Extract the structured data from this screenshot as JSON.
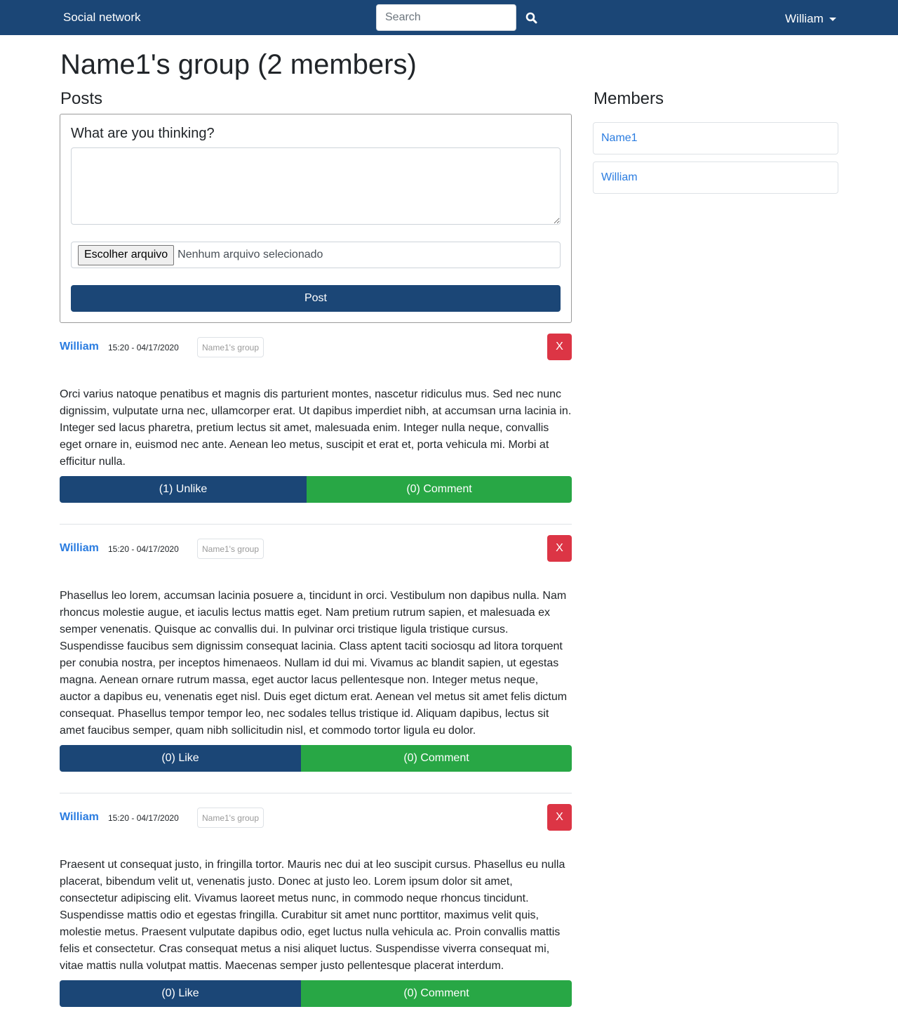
{
  "navbar": {
    "brand": "Social network",
    "search_placeholder": "Search",
    "search_value": "",
    "user_name": "William"
  },
  "page": {
    "title": "Name1's group (2 members)",
    "posts_title": "Posts",
    "members_title": "Members"
  },
  "composer": {
    "label": "What are you thinking?",
    "text_value": "",
    "file_button": "Escolher arquivo",
    "file_status": "Nenhum arquivo selecionado",
    "post_button": "Post"
  },
  "posts": [
    {
      "author": "William",
      "time": "15:20 - 04/17/2020",
      "group": "Name1's group",
      "delete_label": "X",
      "body": "Orci varius natoque penatibus et magnis dis parturient montes, nascetur ridiculus mus. Sed nec nunc dignissim, vulputate urna nec, ullamcorper erat. Ut dapibus imperdiet nibh, at accumsan urna lacinia in. Integer sed lacus pharetra, pretium lectus sit amet, malesuada enim. Integer nulla neque, convallis eget ornare in, euismod nec ante. Aenean leo metus, suscipit et erat et, porta vehicula mi. Morbi at efficitur nulla.",
      "like_label": "(1) Unlike",
      "comment_label": "(0) Comment"
    },
    {
      "author": "William",
      "time": "15:20 - 04/17/2020",
      "group": "Name1's group",
      "delete_label": "X",
      "body": "Phasellus leo lorem, accumsan lacinia posuere a, tincidunt in orci. Vestibulum non dapibus nulla. Nam rhoncus molestie augue, et iaculis lectus mattis eget. Nam pretium rutrum sapien, et malesuada ex semper venenatis. Quisque ac convallis dui. In pulvinar orci tristique ligula tristique cursus. Suspendisse faucibus sem dignissim consequat lacinia. Class aptent taciti sociosqu ad litora torquent per conubia nostra, per inceptos himenaeos. Nullam id dui mi. Vivamus ac blandit sapien, ut egestas magna. Aenean ornare rutrum massa, eget auctor lacus pellentesque non. Integer metus neque, auctor a dapibus eu, venenatis eget nisl. Duis eget dictum erat. Aenean vel metus sit amet felis dictum consequat. Phasellus tempor tempor leo, nec sodales tellus tristique id. Aliquam dapibus, lectus sit amet faucibus semper, quam nibh sollicitudin nisl, et commodo tortor ligula eu dolor.",
      "like_label": "(0) Like",
      "comment_label": "(0) Comment"
    },
    {
      "author": "William",
      "time": "15:20 - 04/17/2020",
      "group": "Name1's group",
      "delete_label": "X",
      "body": "Praesent ut consequat justo, in fringilla tortor. Mauris nec dui at leo suscipit cursus. Phasellus eu nulla placerat, bibendum velit ut, venenatis justo. Donec at justo leo. Lorem ipsum dolor sit amet, consectetur adipiscing elit. Vivamus laoreet metus nunc, in commodo neque rhoncus tincidunt. Suspendisse mattis odio et egestas fringilla. Curabitur sit amet nunc porttitor, maximus velit quis, molestie metus. Praesent vulputate dapibus odio, eget luctus nulla vehicula ac. Proin convallis mattis felis et consectetur. Cras consequat metus a nisi aliquet luctus. Suspendisse viverra consequat mi, vitae mattis nulla volutpat mattis. Maecenas semper justo pellentesque placerat interdum.",
      "like_label": "(0) Like",
      "comment_label": "(0) Comment"
    }
  ],
  "members": [
    {
      "name": "Name1"
    },
    {
      "name": "William"
    }
  ],
  "colors": {
    "navbar": "#1b4676",
    "primary": "#1b4676",
    "success": "#28a745",
    "danger": "#dc3545",
    "link": "#2a7ce0"
  },
  "icons": {
    "search": "search-icon",
    "dropdown": "caret-down-icon"
  }
}
